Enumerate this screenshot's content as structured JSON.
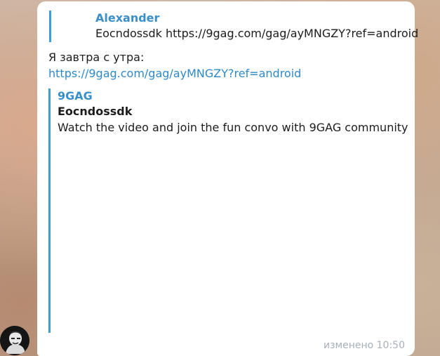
{
  "message": {
    "reply": {
      "author": "Alexander",
      "text": "Eocndossdk https://9gag.com/gag/ayMNGZY?ref=android"
    },
    "text_line": "Я завтра с утра:",
    "link": "https://9gag.com/gag/ayMNGZY?ref=android",
    "preview": {
      "site_name": "9GAG",
      "title": "Eocndossdk",
      "description": "Watch the video and join the fun convo with 9GAG community"
    },
    "edited_label": "изменено",
    "time": "10:50"
  },
  "colors": {
    "accent": "#3b9fd1",
    "link": "#2e89c7",
    "meta": "#a8b0b8"
  },
  "icons": {
    "avatar": "user-avatar-icon"
  }
}
